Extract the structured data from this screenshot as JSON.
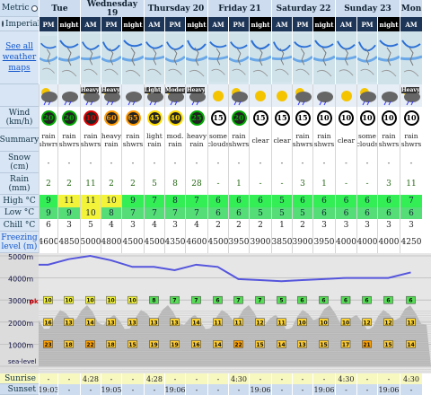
{
  "units": {
    "metric": "Metric",
    "imperial": "Imperial"
  },
  "days": [
    "Tue",
    "Wednesday 19",
    "Thursday 20",
    "Friday 21",
    "Saturday 22",
    "Sunday 23",
    "Mon"
  ],
  "tod": [
    "PM",
    "night",
    "AM",
    "PM",
    "night",
    "AM",
    "PM",
    "night",
    "AM",
    "PM",
    "night",
    "AM",
    "PM",
    "night",
    "AM",
    "PM",
    "night",
    "AM"
  ],
  "see_all_maps": "See all weather maps",
  "labels": {
    "wind": "Wind (km/h)",
    "summary": "Summary",
    "snow": "Snow (cm)",
    "rain": "Rain (mm)",
    "high": "High °C",
    "low": "Low °C",
    "chill": "Chill °C",
    "freezing": "Freezing level (m)",
    "sunrise": "Sunrise",
    "sunset": "Sunset"
  },
  "icon_labels": [
    "",
    "",
    "Heavy",
    "Heavy",
    "",
    "Light",
    "Moderate",
    "Heavy",
    "",
    "",
    "",
    "",
    "",
    "",
    "",
    "",
    "",
    "Heavy"
  ],
  "wind": [
    "20",
    "20",
    "10",
    "60",
    "65",
    "45",
    "40",
    "25",
    "15",
    "20",
    "15",
    "15",
    "15",
    "10",
    "10",
    "10",
    "10",
    "10"
  ],
  "wind_colors": [
    "#00aa00",
    "#00aa00",
    "#dd0000",
    "#ff9900",
    "#ff9900",
    "#ffdd00",
    "#ffdd00",
    "#00aa00",
    "#000",
    "#00aa00",
    "#000",
    "#000",
    "#000",
    "#000",
    "#000",
    "#000",
    "#000",
    "#000"
  ],
  "summary": [
    "rain shwrs",
    "rain shwrs",
    "rain shwrs",
    "heavy rain",
    "rain shwrs",
    "light rain",
    "mod. rain",
    "heavy rain",
    "some clouds",
    "rain shwrs",
    "clear",
    "clear",
    "rain shwrs",
    "rain shwrs",
    "clear",
    "some clouds",
    "rain shwrs",
    "rain shwrs"
  ],
  "snow": [
    "-",
    "-",
    "-",
    "-",
    "-",
    "-",
    "-",
    "-",
    "-",
    "-",
    "-",
    "-",
    "-",
    "-",
    "-",
    "-",
    "-",
    "-"
  ],
  "rain": [
    "2",
    "2",
    "11",
    "2",
    "2",
    "5",
    "8",
    "28",
    "-",
    "1",
    "-",
    "-",
    "3",
    "1",
    "-",
    "-",
    "3",
    "11"
  ],
  "high": [
    "9",
    "11",
    "11",
    "10",
    "9",
    "7",
    "8",
    "7",
    "6",
    "6",
    "6",
    "5",
    "6",
    "6",
    "6",
    "6",
    "6",
    "7"
  ],
  "high_hl": [
    false,
    true,
    true,
    true,
    false,
    false,
    false,
    false,
    false,
    false,
    false,
    false,
    false,
    false,
    false,
    false,
    false,
    false
  ],
  "low": [
    "9",
    "9",
    "10",
    "8",
    "7",
    "7",
    "7",
    "7",
    "6",
    "6",
    "5",
    "5",
    "5",
    "6",
    "6",
    "6",
    "6",
    "6"
  ],
  "low_hl": [
    false,
    false,
    true,
    false,
    false,
    false,
    false,
    false,
    false,
    false,
    false,
    false,
    false,
    false,
    false,
    false,
    false,
    false
  ],
  "chill": [
    "6",
    "3",
    "5",
    "4",
    "3",
    "4",
    "3",
    "4",
    "2",
    "2",
    "2",
    "1",
    "2",
    "3",
    "3",
    "3",
    "3",
    "3"
  ],
  "freezing": [
    "4600",
    "4850",
    "5000",
    "4800",
    "4500",
    "4500",
    "4350",
    "4600",
    "4500",
    "3950",
    "3900",
    "3850",
    "3900",
    "3950",
    "4000",
    "4000",
    "4000",
    "4250"
  ],
  "levels": {
    "l5000": "5000m",
    "l4000": "4000m",
    "l3000": "3000m",
    "l2000": "2000m",
    "l1000": "1000m",
    "sea": "sea-level",
    "pk": "pk"
  },
  "temps_3000": [
    "10",
    "10",
    "10",
    "10",
    "10",
    "8",
    "7",
    "7",
    "6",
    "7",
    "7",
    "5",
    "6",
    "6",
    "6",
    "6",
    "6",
    "6"
  ],
  "temps_2000": [
    "16",
    "13",
    "14",
    "13",
    "13",
    "13",
    "13",
    "14",
    "11",
    "11",
    "12",
    "11",
    "10",
    "10",
    "10",
    "12",
    "12",
    "13"
  ],
  "temps_1000": [
    "23",
    "18",
    "22",
    "18",
    "15",
    "19",
    "19",
    "16",
    "14",
    "22",
    "15",
    "14",
    "13",
    "15",
    "17",
    "21",
    "15",
    "14"
  ],
  "sunrise": [
    "-",
    "-",
    "4:28",
    "-",
    "-",
    "4:28",
    "-",
    "-",
    "-",
    "4:30",
    "-",
    "-",
    "-",
    "-",
    "4:30",
    "-",
    "-",
    "4:30"
  ],
  "sunset": [
    "19:03",
    "-",
    "-",
    "19:05",
    "-",
    "-",
    "19:06",
    "-",
    "-",
    "-",
    "19:06",
    "-",
    "-",
    "19:06",
    "-",
    "-",
    "19:06",
    "-"
  ],
  "colors": {
    "freezing_line": "#5555dd",
    "label_bg": "#d7e5f5"
  }
}
